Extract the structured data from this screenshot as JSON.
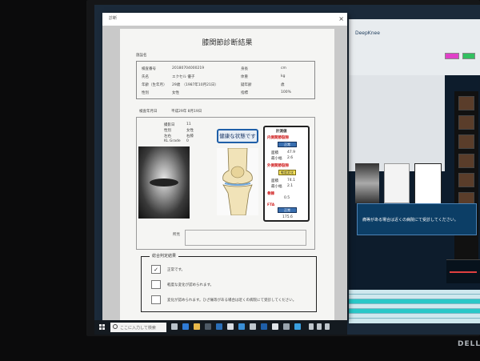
{
  "window": {
    "title": "診断",
    "close_label": "×"
  },
  "document": {
    "title": "膝関節診断結果",
    "section_label": "施設名",
    "patient_fields": [
      {
        "label": "検査番号",
        "value": "20180704000219"
      },
      {
        "label": "氏名",
        "value": "エクセル 優子"
      },
      {
        "label": "年齢（生年月）",
        "value": "29歳　（1987年10月21日）"
      },
      {
        "label": "性別",
        "value": "女性"
      },
      {
        "label": "身長",
        "value": "cm"
      },
      {
        "label": "体重",
        "value": "kg"
      },
      {
        "label": "疑年齢",
        "value": "歳"
      },
      {
        "label": "指標",
        "value": "100%"
      }
    ],
    "exam_date_label": "検査年月日",
    "exam_date_value": "平成29年 8月19日",
    "summary_fields": [
      {
        "label": "撮影日",
        "value": "11"
      },
      {
        "label": "性別",
        "value": "女性"
      },
      {
        "label": "左右",
        "value": "右膝"
      },
      {
        "label": "KL Grade",
        "value": "0"
      }
    ],
    "status_label": "健康な状態です",
    "measurements": {
      "title": "計測値",
      "inner_label": "内側関節裂隙",
      "inner_button": "正常",
      "inner_value_label": "面積",
      "inner_value": "47.9",
      "inner_width_label": "最小幅",
      "inner_width": "2.6",
      "outer_label": "外側関節裂隙",
      "outer_badge": "軽度変化",
      "outer_value_label": "面積",
      "outer_value": "74.1",
      "outer_width_label": "最小幅",
      "outer_width": "2.1",
      "bone_label": "骨棘",
      "bone_value": "0.5",
      "fta_label": "FTA",
      "fta_button": "正常",
      "fta_value": "175.6"
    },
    "remarks_label": "所見",
    "conclusion_title": "総合判定結果",
    "conclusion_items": [
      {
        "checked": "✓",
        "text": "正常です。"
      },
      {
        "checked": "",
        "text": "軽度な変化が認められます。"
      },
      {
        "checked": "",
        "text": "変化が認められます。ひざ痛等がある場合は近くの病院にて受診してください。"
      }
    ]
  },
  "background_app": {
    "title": "DeepKnee",
    "dialog_text": "痛等がある場合は近くの病院にて受診してください。"
  },
  "taskbar": {
    "search_placeholder": "ここに入力して検索"
  },
  "brand": "DELL"
}
